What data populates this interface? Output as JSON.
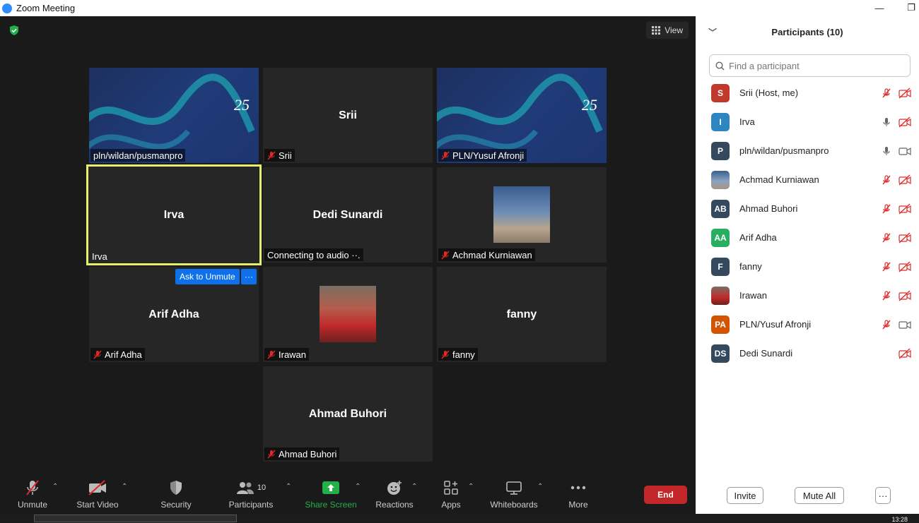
{
  "window": {
    "title": "Zoom Meeting",
    "minimize_glyph": "—",
    "restore_glyph": "❐"
  },
  "view": {
    "label": "View"
  },
  "tiles": {
    "t1": {
      "label": "pln/wildan/pusmanpro"
    },
    "t2": {
      "center": "Srii",
      "label": "Srii"
    },
    "t3": {
      "label": "PLN/Yusuf Afronji"
    },
    "t4": {
      "center": "Irva",
      "label": "Irva"
    },
    "t5": {
      "center": "Dedi Sunardi",
      "label": "Connecting to audio ··."
    },
    "t6": {
      "label": "Achmad Kurniawan"
    },
    "t7": {
      "center": "Arif Adha",
      "label": "Arif Adha"
    },
    "t8": {
      "label": "Irawan"
    },
    "t9": {
      "center": "fanny",
      "label": "fanny"
    },
    "t10": {
      "center": "Ahmad Buhori",
      "label": "Ahmad Buhori"
    }
  },
  "hover": {
    "ask_unmute": "Ask to Unmute",
    "more": "···"
  },
  "toolbar": {
    "unmute": "Unmute",
    "start_video": "Start Video",
    "security": "Security",
    "participants": "Participants",
    "participants_count": "10",
    "share": "Share Screen",
    "reactions": "Reactions",
    "apps": "Apps",
    "whiteboards": "Whiteboards",
    "more": "More",
    "end": "End"
  },
  "panel": {
    "title": "Participants (10)",
    "search_placeholder": "Find a participant",
    "participants": [
      {
        "initials": "S",
        "name": "Srii (Host, me)",
        "color": "#c0392b",
        "mic": "muted",
        "video": "off"
      },
      {
        "initials": "I",
        "name": "Irva",
        "color": "#2e86c1",
        "mic": "on",
        "video": "off"
      },
      {
        "initials": "P",
        "name": "pln/wildan/pusmanpro",
        "color": "#34495e",
        "mic": "on",
        "video": "on"
      },
      {
        "initials": "",
        "name": "Achmad Kurniawan",
        "color": "#5d6d8a",
        "mic": "muted",
        "video": "off"
      },
      {
        "initials": "AB",
        "name": "Ahmad Buhori",
        "color": "#34495e",
        "mic": "muted",
        "video": "off"
      },
      {
        "initials": "AA",
        "name": "Arif Adha",
        "color": "#27ae60",
        "mic": "muted",
        "video": "off"
      },
      {
        "initials": "F",
        "name": "fanny",
        "color": "#34495e",
        "mic": "muted",
        "video": "off"
      },
      {
        "initials": "",
        "name": "Irawan",
        "color": "#a93226",
        "mic": "muted",
        "video": "off"
      },
      {
        "initials": "PA",
        "name": "PLN/Yusuf Afronji",
        "color": "#d35400",
        "mic": "muted",
        "video": "on"
      },
      {
        "initials": "DS",
        "name": "Dedi Sunardi",
        "color": "#34495e",
        "mic": "none",
        "video": "off"
      }
    ],
    "invite": "Invite",
    "mute_all": "Mute All",
    "more": "···"
  },
  "taskbar": {
    "clock": "13:28"
  }
}
